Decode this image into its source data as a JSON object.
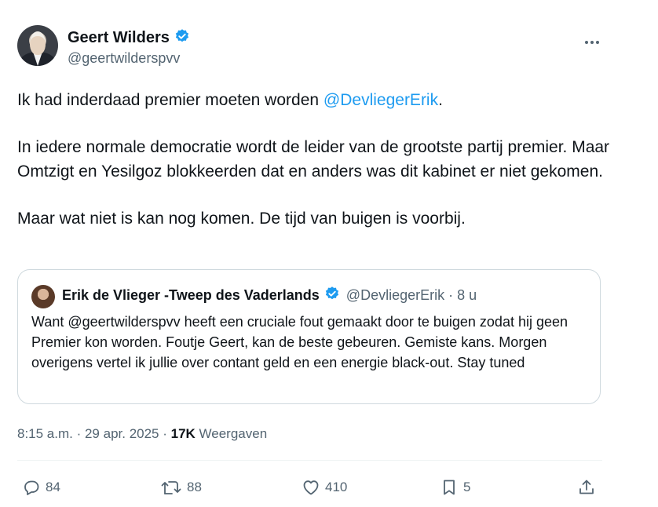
{
  "author": {
    "display_name": "Geert Wilders",
    "handle": "@geertwilderspvv",
    "verified": true
  },
  "more_icon": "more-icon",
  "tweet": {
    "line1_text": "Ik had inderdaad premier moeten worden ",
    "line1_mention": "@DevliegerErik",
    "line1_end": ".",
    "paragraph2": "In iedere normale democratie wordt de leider van de grootste partij premier. Maar Omtzigt en Yesilgoz blokkeerden dat en anders was dit kabinet er niet gekomen.",
    "paragraph3": "Maar wat niet is kan nog komen. De tijd van buigen is voorbij."
  },
  "quote": {
    "display_name": "Erik de Vlieger -Tweep des Vaderlands",
    "handle_time": "@DevliegerErik · 8 u",
    "text": "Want @geertwilderspvv heeft een cruciale fout gemaakt door te buigen zodat hij geen Premier kon worden.  Foutje Geert, kan de beste gebeuren.  Gemiste kans.  Morgen overigens vertel ik jullie over contant geld en een energie black-out. Stay tuned"
  },
  "meta": {
    "time_date": "8:15 a.m. · 29 apr. 2025 · ",
    "views_count": "17K",
    "views_label": " Weergaven"
  },
  "actions": {
    "replies": "84",
    "reposts": "88",
    "likes": "410",
    "bookmarks": "5"
  },
  "colors": {
    "accent": "#1d9bf0",
    "secondary_text": "#536471",
    "border": "#cfd9de"
  }
}
